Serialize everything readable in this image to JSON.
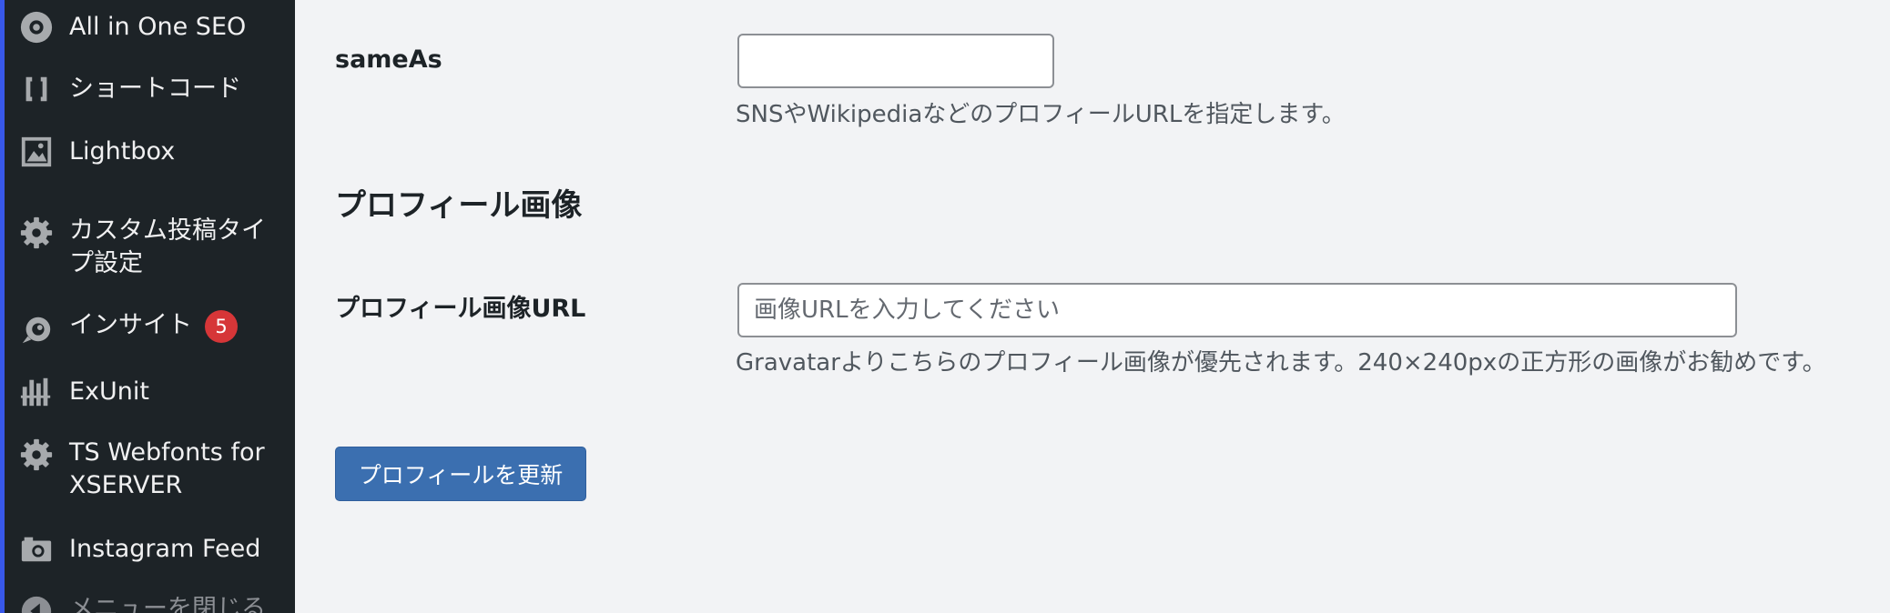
{
  "sidebar": {
    "items": [
      {
        "label": "All in One SEO",
        "icon": "aioseo-icon"
      },
      {
        "label": "ショートコード",
        "icon": "shortcode-brackets-icon"
      },
      {
        "label": "Lightbox",
        "icon": "image-icon"
      },
      {
        "label": "カスタム投稿タイプ設定",
        "icon": "gear-icon"
      },
      {
        "label": "インサイト",
        "icon": "insights-icon",
        "badge": "5"
      },
      {
        "label": "ExUnit",
        "icon": "exunit-icon"
      },
      {
        "label": "TS Webfonts for XSERVER",
        "icon": "gear-icon"
      },
      {
        "label": "Instagram Feed",
        "icon": "camera-icon"
      },
      {
        "label": "メニューを閉じる",
        "icon": "collapse-arrow-icon"
      }
    ]
  },
  "form": {
    "sameas": {
      "label": "sameAs",
      "value": "",
      "description": "SNSやWikipediaなどのプロフィールURLを指定します。"
    },
    "section_title": "プロフィール画像",
    "image_url": {
      "label": "プロフィール画像URL",
      "value": "",
      "placeholder": "画像URLを入力してください",
      "description": "Gravatarよりこちらのプロフィール画像が優先されます。240×240pxの正方形の画像がお勧めです。"
    },
    "submit_label": "プロフィールを更新"
  },
  "colors": {
    "sidebar_bg": "#1d2327",
    "accent": "#3858e9",
    "button": "#3b6fb0",
    "badge": "#d63638"
  }
}
